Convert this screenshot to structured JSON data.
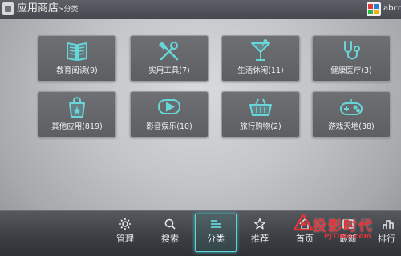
{
  "header": {
    "title": "应用商店",
    "breadcrumb": ">分类",
    "brand": "abcd"
  },
  "categories": [
    {
      "label": "教育阅读(9)",
      "icon": "book-icon"
    },
    {
      "label": "实用工具(7)",
      "icon": "tools-icon"
    },
    {
      "label": "生活休闲(11)",
      "icon": "cocktail-icon"
    },
    {
      "label": "健康医疗(3)",
      "icon": "stethoscope-icon"
    },
    {
      "label": "其他应用(819)",
      "icon": "shopping-bag-icon"
    },
    {
      "label": "影音娱乐(10)",
      "icon": "play-icon"
    },
    {
      "label": "旅行购物(2)",
      "icon": "basket-icon"
    },
    {
      "label": "游戏天地(38)",
      "icon": "gamepad-icon"
    }
  ],
  "nav": [
    {
      "label": "管理",
      "icon": "gear-icon"
    },
    {
      "label": "搜索",
      "icon": "search-icon"
    },
    {
      "label": "分类",
      "icon": "category-icon",
      "active": true
    },
    {
      "label": "推荐",
      "icon": "star-icon"
    },
    {
      "label": "首页",
      "icon": "home-icon"
    },
    {
      "label": "最新",
      "icon": "new-icon"
    },
    {
      "label": "排行",
      "icon": "ranking-icon"
    }
  ],
  "watermark": {
    "text": "投影时代",
    "url": "PJTime.com"
  },
  "colors": {
    "accent": "#5fd2d5",
    "tile": "#646669",
    "header": "#4f5257",
    "watermark": "#e0353a"
  }
}
